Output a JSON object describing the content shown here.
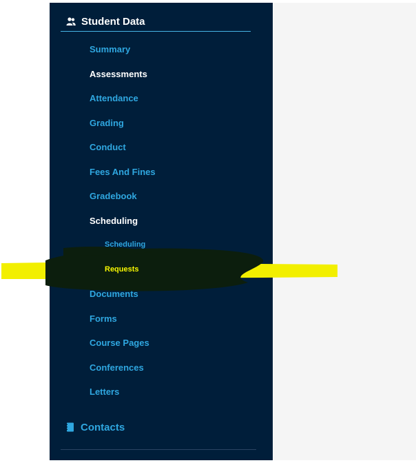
{
  "sidebar": {
    "section_title": "Student Data",
    "section_icon": "users-icon",
    "items": [
      {
        "label": "Summary"
      },
      {
        "label": "Assessments"
      },
      {
        "label": "Attendance"
      },
      {
        "label": "Grading"
      },
      {
        "label": "Conduct"
      },
      {
        "label": "Fees And Fines"
      },
      {
        "label": "Gradebook"
      },
      {
        "label": "Scheduling"
      },
      {
        "label": "Scheduling"
      },
      {
        "label": "Requests"
      },
      {
        "label": "Documents"
      },
      {
        "label": "Forms"
      },
      {
        "label": "Course Pages"
      },
      {
        "label": "Conferences"
      },
      {
        "label": "Letters"
      }
    ],
    "contacts_label": "Contacts",
    "contacts_icon": "address-book-icon"
  },
  "colors": {
    "sidebar_bg": "#001e3a",
    "link": "#2fa7e0",
    "active": "#ffffff",
    "selected": "#f7f700",
    "highlight": "#f2ef00"
  }
}
